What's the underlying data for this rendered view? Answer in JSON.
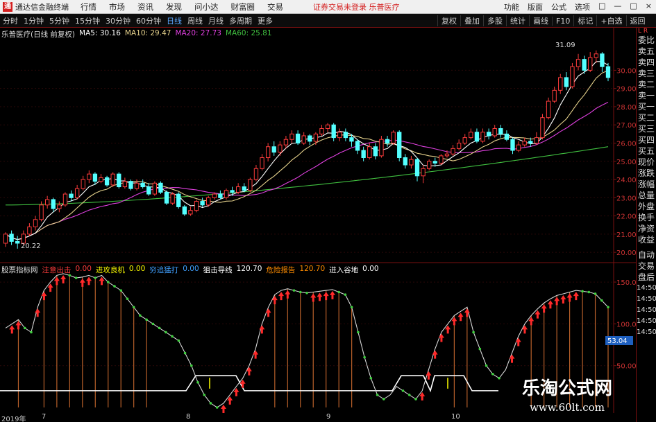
{
  "app": {
    "logo_text": "通",
    "name": "通达信金融终端",
    "menus": [
      "行情",
      "市场",
      "资讯",
      "发现",
      "问小达",
      "财富圈",
      "交易"
    ],
    "notice": "证券交易未登录 乐普医疗",
    "right_menus": [
      "功能",
      "版面",
      "公式",
      "选项",
      "□",
      "—",
      "□",
      "×"
    ]
  },
  "toolbar": {
    "periods": [
      "分时",
      "1分钟",
      "5分钟",
      "15分钟",
      "30分钟",
      "60分钟",
      "日线",
      "周线",
      "月线",
      "多周期",
      "更多"
    ],
    "active_period": "日线",
    "tools": [
      "复权",
      "叠加",
      "多股",
      "统计",
      "画线",
      "F10",
      "标记",
      "+自选",
      "返回"
    ]
  },
  "main_chart": {
    "stock_title": "乐普医疗(日线 前复权)",
    "ma5": "MA5: 30.16",
    "ma10": "MA10: 29.47",
    "ma20": "MA20: 27.73",
    "ma60": "MA60: 25.81",
    "high_label": "31.09",
    "low_label": "20.22",
    "y_ticks": [
      "30.00",
      "29.00",
      "28.00",
      "27.00",
      "26.00",
      "25.00",
      "24.00",
      "23.00",
      "22.00",
      "21.00",
      "20.00"
    ],
    "colors": {
      "up": "#ff3c3c",
      "down": "#54ffff",
      "ma5": "#ffffff",
      "ma10": "#e6d28c",
      "ma20": "#e040e0",
      "ma60": "#40c040"
    }
  },
  "indicator": {
    "name": "股票指标网",
    "items": [
      {
        "label": "注意出击",
        "value": "0.00",
        "color": "#ff3c3c"
      },
      {
        "label": "进攻良机",
        "value": "0.00",
        "color": "#ffff00"
      },
      {
        "label": "穷追猛打",
        "value": "0.00",
        "color": "#40a0ff"
      },
      {
        "label": "狙击导线",
        "value": "120.70",
        "color": "#ffffff"
      },
      {
        "label": "危险报告",
        "value": "120.70",
        "color": "#ff8c00"
      },
      {
        "label": "进入谷地",
        "value": "0.00",
        "color": "#ffffff"
      }
    ],
    "y_ticks": [
      "150.0",
      "100.0",
      "50.00"
    ],
    "current_value": "53.04"
  },
  "side_panel": {
    "lr": "L R",
    "items": [
      "委比",
      "卖五",
      "卖四",
      "卖三",
      "卖二",
      "卖一",
      "买一",
      "买二",
      "买三",
      "买四",
      "买五",
      "现价",
      "涨跌",
      "涨幅",
      "总量",
      "外盘",
      "换手",
      "净资",
      "收益",
      "自动",
      "交易",
      "盘后",
      "14:50",
      "14:50",
      "14:50",
      "14:50",
      "14:50"
    ]
  },
  "date_axis": {
    "labels": [
      "2019年",
      "7",
      "8",
      "9",
      "10"
    ]
  },
  "watermark": {
    "title": "乐淘公式网",
    "url": "www.60lt.com"
  },
  "chart_data": [
    {
      "type": "candlestick",
      "title": "乐普医疗(日线 前复权)",
      "ylim": [
        19.7,
        31.5
      ],
      "candles": [
        [
          20.5,
          21.0,
          20.3,
          21.1
        ],
        [
          21.0,
          20.6,
          20.4,
          21.2
        ],
        [
          20.6,
          20.5,
          20.2,
          20.9
        ],
        [
          20.5,
          21.0,
          20.4,
          21.2
        ],
        [
          21.0,
          21.4,
          20.9,
          21.6
        ],
        [
          21.4,
          21.8,
          21.2,
          22.0
        ],
        [
          21.8,
          22.6,
          21.7,
          22.8
        ],
        [
          22.6,
          22.9,
          22.4,
          23.1
        ],
        [
          22.9,
          22.4,
          22.2,
          23.0
        ],
        [
          22.4,
          22.6,
          22.2,
          22.8
        ],
        [
          22.6,
          23.2,
          22.5,
          23.3
        ],
        [
          23.2,
          23.0,
          22.8,
          23.4
        ],
        [
          23.0,
          23.5,
          22.9,
          23.7
        ],
        [
          23.5,
          24.0,
          23.4,
          24.2
        ],
        [
          24.0,
          24.3,
          23.8,
          24.5
        ],
        [
          24.3,
          23.9,
          23.7,
          24.4
        ],
        [
          23.9,
          24.1,
          23.8,
          24.3
        ],
        [
          24.1,
          23.7,
          23.6,
          24.2
        ],
        [
          23.7,
          24.3,
          23.6,
          24.4
        ],
        [
          24.3,
          23.6,
          23.5,
          24.4
        ],
        [
          23.6,
          23.9,
          23.5,
          24.1
        ],
        [
          23.9,
          23.5,
          23.4,
          24.0
        ],
        [
          23.5,
          23.8,
          23.4,
          24.0
        ],
        [
          23.8,
          23.6,
          23.5,
          24.0
        ],
        [
          23.6,
          23.2,
          23.1,
          23.8
        ],
        [
          23.2,
          23.8,
          23.1,
          23.9
        ],
        [
          23.8,
          23.3,
          23.2,
          23.9
        ],
        [
          23.3,
          22.7,
          22.6,
          23.4
        ],
        [
          22.7,
          23.2,
          22.6,
          23.3
        ],
        [
          23.2,
          22.5,
          22.4,
          23.3
        ],
        [
          22.5,
          22.1,
          22.0,
          22.6
        ],
        [
          22.1,
          22.3,
          22.0,
          22.5
        ],
        [
          22.3,
          22.8,
          22.2,
          22.9
        ],
        [
          22.8,
          22.6,
          22.5,
          23.0
        ],
        [
          22.6,
          23.0,
          22.5,
          23.1
        ],
        [
          23.0,
          23.2,
          22.9,
          23.3
        ],
        [
          23.2,
          23.0,
          22.9,
          23.4
        ],
        [
          23.0,
          23.4,
          22.9,
          23.5
        ],
        [
          23.4,
          23.3,
          23.1,
          23.6
        ],
        [
          23.3,
          23.6,
          23.2,
          23.8
        ],
        [
          23.6,
          23.4,
          23.3,
          23.8
        ],
        [
          23.4,
          24.0,
          23.3,
          24.1
        ],
        [
          24.0,
          24.6,
          23.9,
          24.8
        ],
        [
          24.6,
          25.2,
          24.5,
          25.4
        ],
        [
          25.2,
          25.8,
          25.0,
          26.0
        ],
        [
          25.8,
          25.5,
          25.3,
          26.1
        ],
        [
          25.5,
          25.9,
          25.3,
          26.1
        ],
        [
          25.9,
          26.2,
          25.7,
          26.4
        ],
        [
          26.2,
          26.5,
          26.0,
          26.7
        ],
        [
          26.5,
          26.0,
          25.9,
          26.7
        ],
        [
          26.0,
          26.4,
          25.9,
          26.6
        ],
        [
          26.4,
          26.1,
          25.9,
          26.5
        ],
        [
          26.1,
          26.5,
          25.9,
          26.6
        ],
        [
          26.5,
          26.8,
          26.4,
          27.0
        ],
        [
          26.8,
          27.0,
          26.6,
          27.1
        ],
        [
          27.0,
          26.3,
          26.1,
          27.1
        ],
        [
          26.3,
          26.6,
          26.1,
          26.8
        ],
        [
          26.6,
          26.3,
          26.1,
          26.8
        ],
        [
          26.3,
          26.1,
          25.8,
          26.5
        ],
        [
          26.1,
          25.6,
          25.4,
          26.2
        ],
        [
          25.6,
          25.2,
          25.0,
          25.8
        ],
        [
          25.2,
          25.8,
          25.1,
          26.0
        ],
        [
          25.8,
          25.3,
          25.1,
          26.0
        ],
        [
          25.3,
          26.2,
          25.2,
          26.4
        ],
        [
          26.2,
          26.0,
          25.8,
          26.4
        ],
        [
          26.0,
          26.6,
          25.9,
          26.7
        ],
        [
          26.6,
          25.2,
          25.0,
          26.7
        ],
        [
          25.2,
          24.8,
          24.6,
          25.4
        ],
        [
          24.8,
          25.1,
          24.6,
          25.3
        ],
        [
          25.1,
          24.2,
          23.9,
          25.2
        ],
        [
          24.2,
          24.6,
          23.8,
          24.8
        ],
        [
          24.6,
          25.0,
          24.5,
          25.1
        ],
        [
          25.0,
          24.9,
          24.7,
          25.2
        ],
        [
          24.9,
          25.3,
          24.8,
          25.4
        ],
        [
          25.3,
          25.4,
          25.2,
          25.6
        ],
        [
          25.4,
          25.7,
          25.3,
          25.9
        ],
        [
          25.7,
          26.0,
          25.6,
          26.2
        ],
        [
          26.0,
          26.3,
          25.9,
          26.5
        ],
        [
          26.3,
          26.6,
          26.2,
          26.8
        ],
        [
          26.6,
          26.1,
          26.0,
          26.8
        ],
        [
          26.1,
          26.6,
          26.0,
          26.8
        ],
        [
          26.6,
          26.4,
          26.2,
          26.8
        ],
        [
          26.4,
          26.8,
          26.3,
          27.0
        ],
        [
          26.8,
          26.5,
          26.3,
          27.0
        ],
        [
          26.5,
          26.2,
          26.1,
          26.7
        ],
        [
          26.2,
          25.6,
          25.4,
          26.3
        ],
        [
          25.6,
          25.9,
          25.5,
          26.1
        ],
        [
          25.9,
          26.1,
          25.8,
          26.3
        ],
        [
          26.1,
          26.0,
          25.8,
          26.3
        ],
        [
          26.0,
          26.3,
          25.9,
          26.6
        ],
        [
          26.3,
          27.4,
          26.2,
          27.6
        ],
        [
          27.4,
          28.3,
          27.3,
          28.5
        ],
        [
          28.3,
          28.9,
          28.2,
          29.1
        ],
        [
          28.9,
          29.6,
          28.7,
          29.8
        ],
        [
          29.6,
          29.1,
          28.9,
          29.9
        ],
        [
          29.1,
          30.2,
          29.0,
          30.4
        ],
        [
          30.2,
          30.6,
          30.0,
          30.9
        ],
        [
          30.6,
          30.0,
          29.8,
          30.8
        ],
        [
          30.0,
          30.7,
          29.9,
          31.0
        ],
        [
          30.7,
          30.9,
          30.4,
          31.09
        ],
        [
          30.9,
          30.2,
          29.9,
          31.0
        ],
        [
          30.2,
          29.6,
          29.4,
          30.4
        ]
      ]
    },
    {
      "type": "line",
      "title": "股票指标网",
      "ylim": [
        0,
        160
      ],
      "series": [
        {
          "name": "狙击导线",
          "values": [
            95,
            100,
            105,
            95,
            90,
            120,
            140,
            150,
            158,
            160,
            158,
            155,
            156,
            158,
            155,
            158,
            150,
            145,
            140,
            130,
            120,
            110,
            105,
            100,
            95,
            90,
            85,
            80,
            65,
            50,
            30,
            15,
            5,
            0,
            5,
            15,
            25,
            35,
            50,
            70,
            100,
            120,
            135,
            140,
            142,
            140,
            138,
            137,
            138,
            139,
            140,
            141,
            138,
            135,
            120,
            90,
            60,
            35,
            15,
            10,
            15,
            25,
            20,
            15,
            10,
            20,
            45,
            70,
            90,
            100,
            110,
            115,
            120,
            90,
            70,
            50,
            40,
            35,
            45,
            65,
            85,
            100,
            110,
            118,
            125,
            130,
            134,
            136,
            138,
            140,
            139,
            138,
            136,
            128,
            120
          ]
        }
      ]
    }
  ]
}
